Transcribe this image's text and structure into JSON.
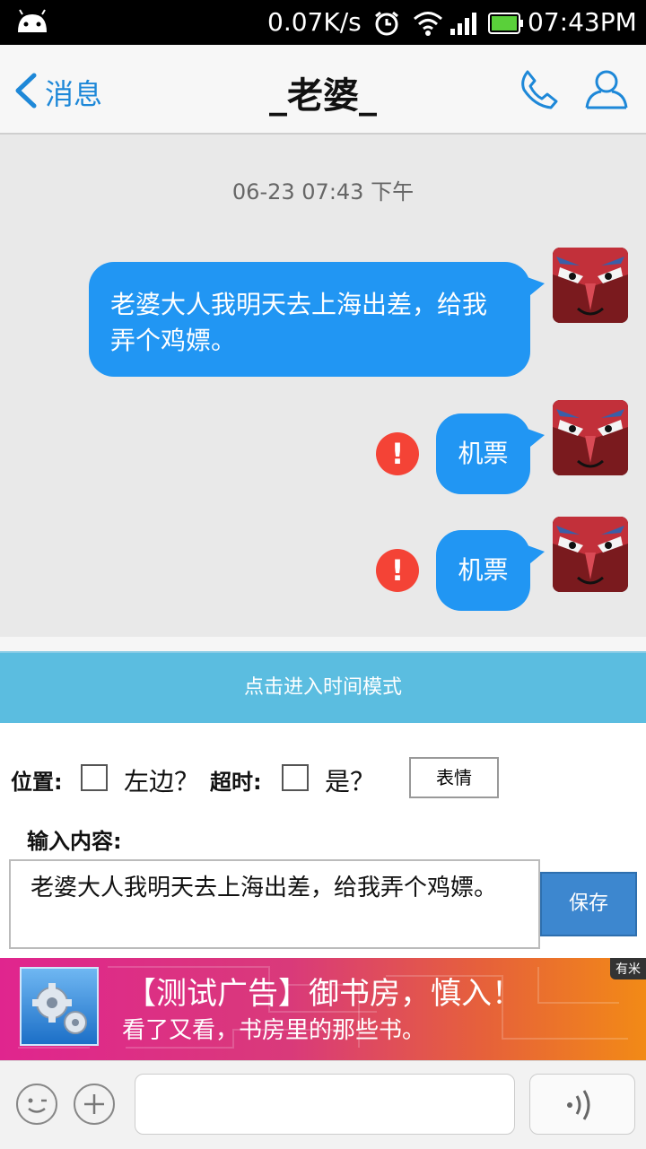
{
  "status_bar": {
    "speed": "0.07K/s",
    "time": "07:43PM"
  },
  "header": {
    "back_label": "消息",
    "title": "_老婆_"
  },
  "chat": {
    "timestamp": "06-23 07:43 下午",
    "messages": [
      {
        "text": "老婆大人我明天去上海出差，给我弄个鸡嫖。",
        "failed": false
      },
      {
        "text": "机票",
        "failed": true
      },
      {
        "text": "机票",
        "failed": true
      }
    ],
    "error_glyph": "!"
  },
  "mode_bar": {
    "label": "点击进入时间模式"
  },
  "panel": {
    "position_label": "位置:",
    "left_label": "左边？",
    "timeout_label": "超时:",
    "yes_label": "是？",
    "emoji_button": "表情",
    "input_label": "输入内容:",
    "input_value": "老婆大人我明天去上海出差，给我弄个鸡嫖。",
    "save_button": "保存"
  },
  "ad": {
    "badge": "有米",
    "title": "【测试广告】御书房，慎入！",
    "subtitle": "看了又看，书房里的那些书。"
  },
  "colors": {
    "accent": "#1e88d8",
    "bubble": "#2196f3",
    "error": "#f44336",
    "mode_bar": "#5bbde0",
    "save": "#3d87cf"
  }
}
